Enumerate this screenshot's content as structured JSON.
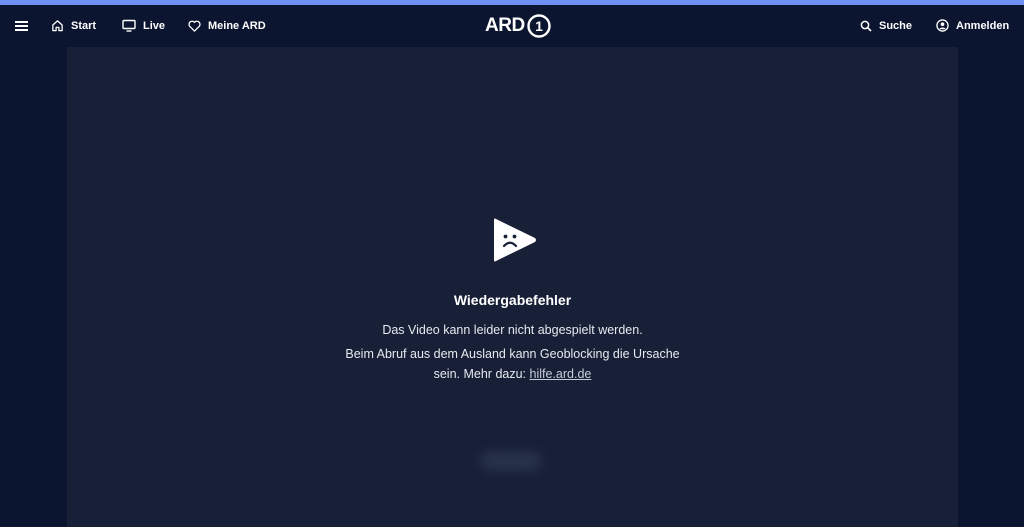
{
  "header": {
    "nav": {
      "start": "Start",
      "live": "Live",
      "meine_ard": "Meine ARD"
    },
    "logo_text": "ARD",
    "logo_number": "1",
    "search": "Suche",
    "login": "Anmelden"
  },
  "player": {
    "error_title": "Wiedergabefehler",
    "message_line1": "Das Video kann leider nicht abgespielt werden.",
    "message_line2": "Beim Abruf aus dem Ausland kann Geoblocking die Ursache",
    "message_line3": "sein. Mehr dazu:",
    "help_link": "hilfe.ard.de"
  },
  "colors": {
    "accent_bar": "#6f8ff2",
    "background": "#0b1530",
    "player_bg": "#172036"
  }
}
